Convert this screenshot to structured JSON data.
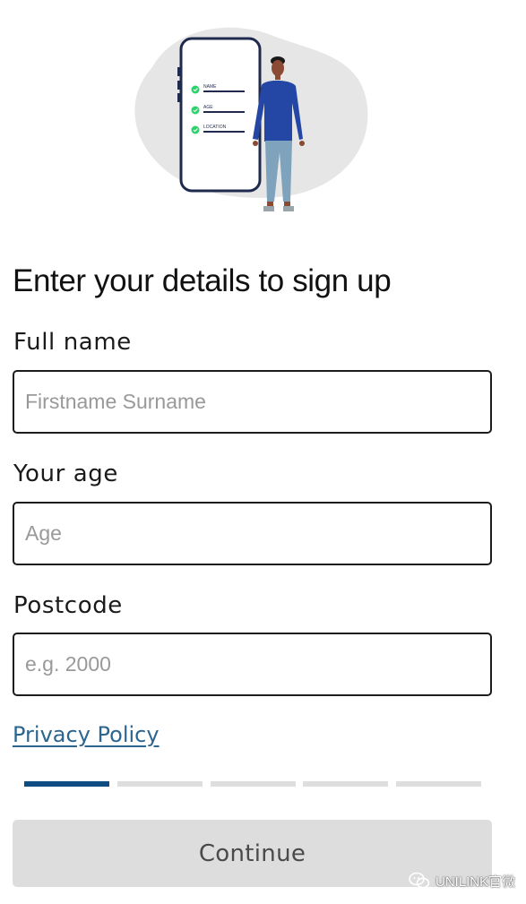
{
  "illustration": {
    "icon": "signup-person-phone-illustration",
    "checklist": [
      "NAME",
      "AGE",
      "LOCATION"
    ],
    "colors": {
      "blob": "#e6e6e6",
      "phone_frame": "#1f2a4d",
      "check": "#2bd26a",
      "sweater": "#2447a6",
      "pants": "#7fa2bd",
      "skin": "#8a4a34"
    }
  },
  "form": {
    "title": "Enter your details to sign up",
    "fields": [
      {
        "label": "Full name",
        "placeholder": "Firstname Surname",
        "value": ""
      },
      {
        "label": "Your age",
        "placeholder": "Age",
        "value": ""
      },
      {
        "label": "Postcode",
        "placeholder": "e.g. 2000",
        "value": ""
      }
    ],
    "privacy_link": "Privacy Policy",
    "continue_label": "Continue"
  },
  "progress": {
    "current_step": 1,
    "total_steps": 5
  },
  "watermark": {
    "text": "UNILINK官微",
    "icon": "wechat-icon"
  },
  "colors": {
    "link": "#2b6590",
    "progress_active": "#0f4c81",
    "progress_inactive": "#dedede",
    "button_disabled_bg": "#dddddd",
    "button_disabled_text": "#4a4a4a"
  }
}
